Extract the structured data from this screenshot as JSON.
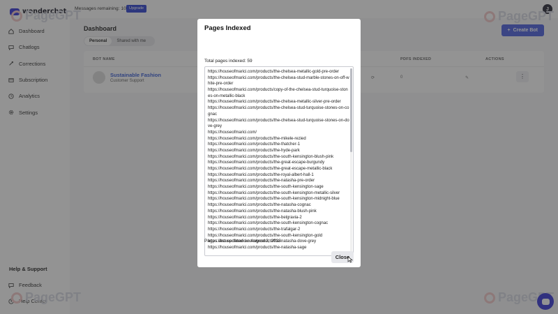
{
  "app": {
    "name": "wonderchat",
    "avatar_initial": "J"
  },
  "topbar": {
    "messages_remaining": "Messages remaining: 10",
    "upgrade_label": "Upgrade"
  },
  "sidebar": {
    "items": [
      {
        "label": "Dashboard",
        "icon": "home-icon"
      },
      {
        "label": "Chatlogs",
        "icon": "chat-icon"
      },
      {
        "label": "Corrections",
        "icon": "corrections-icon"
      },
      {
        "label": "Subscription",
        "icon": "card-icon"
      },
      {
        "label": "Analytics",
        "icon": "clock-icon"
      },
      {
        "label": "Settings",
        "icon": "gear-icon"
      }
    ],
    "help_title": "Help & Support",
    "help_items": [
      {
        "label": "Feedback",
        "icon": "feedback-icon"
      },
      {
        "label": "Help Center",
        "icon": "help-icon"
      }
    ]
  },
  "main": {
    "title": "Dashboard",
    "create_label": "Create Bot",
    "toggle": [
      "Personal",
      "Shared with me"
    ],
    "columns": {
      "bot_name": "BOT NAME",
      "pdfs_indexed": "PDFS INDEXED",
      "actions": "ACTIONS"
    },
    "row": {
      "name": "Sustainable Fashion",
      "subtitle": "Customer Support",
      "pdfs": "0"
    }
  },
  "watermark": "PageGPT",
  "modal": {
    "title": "Pages Indexed",
    "total": "Total pages indexed: 59",
    "last_updated": "Pages last updated on August 3, 2023",
    "close_label": "Close",
    "urls": [
      "https://houseofmarici.com/products/the-chelsea-metallic-gold-pre-order",
      "https://houseofmarici.com/products/the-chelsea-stud-marble-stones-on-off-white-pre-order",
      "https://houseofmarici.com/products/copy-of-the-chelsea-stud-turquoise-stones-on-metallic-black",
      "https://houseofmarici.com/products/the-chelsea-metallic-silver-pre-order",
      "https://houseofmarici.com/products/the-chelsea-stud-turquoise-stones-on-cognac",
      "https://houseofmarici.com/products/the-chelsea-stud-turquoise-stones-on-dove-grey",
      "https://houseofmarici.com/",
      "https://houseofmarici.com/products/the-mikele-rezied",
      "https://houseofmarici.com/products/the-thatcher-1",
      "https://houseofmarici.com/products/the-hyde-park",
      "https://houseofmarici.com/products/the-south-kensington-blush-pink",
      "https://houseofmarici.com/products/the-great-escape-burgundy",
      "https://houseofmarici.com/products/the-great-escape-metallic-black",
      "https://houseofmarici.com/products/the-royal-albert-hall-1",
      "https://houseofmarici.com/products/the-natasha-pre-order",
      "https://houseofmarici.com/products/the-south-kensington-sage",
      "https://houseofmarici.com/products/the-south-kensington-metallic-silver",
      "https://houseofmarici.com/products/the-south-kensington-midnight-blue",
      "https://houseofmarici.com/products/the-natasha-cognac",
      "https://houseofmarici.com/products/the-natasha-blush-pink",
      "https://houseofmarici.com/products/the-belgravia-2",
      "https://houseofmarici.com/products/the-south-kensington-cognac",
      "https://houseofmarici.com/products/the-trafalgar-2",
      "https://houseofmarici.com/products/the-south-kensington-gold",
      "https://houseofmarici.com/products/the-natasha-dove-grey",
      "https://houseofmarici.com/products/the-natasha-sage"
    ]
  },
  "colors": {
    "accent": "#3b3bd6",
    "overlay": "rgba(40,40,40,0.5)"
  }
}
